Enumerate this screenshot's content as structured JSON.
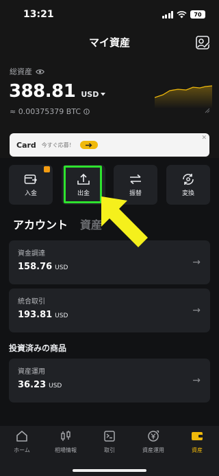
{
  "status_bar": {
    "time": "13:21",
    "battery": "70"
  },
  "header": {
    "title": "マイ資産"
  },
  "balance": {
    "label": "総資産",
    "value": "388.81",
    "currency": "USD",
    "btc_equivalent": "≈ 0.00375379 BTC"
  },
  "banner": {
    "title": "Card",
    "subtitle": "今すぐ応募！"
  },
  "actions": [
    {
      "label": "入金",
      "icon": "deposit-icon"
    },
    {
      "label": "出金",
      "icon": "withdraw-icon"
    },
    {
      "label": "振替",
      "icon": "transfer-icon"
    },
    {
      "label": "変換",
      "icon": "convert-icon"
    }
  ],
  "tabs": {
    "account": "アカウント",
    "assets": "資産"
  },
  "cards": [
    {
      "title": "資金調達",
      "value": "158.76",
      "unit": "USD"
    },
    {
      "title": "統合取引",
      "value": "193.81",
      "unit": "USD"
    },
    {
      "title": "資産運用",
      "value": "36.23",
      "unit": "USD"
    }
  ],
  "invested_heading": "投資済みの商品",
  "bottom_nav": [
    {
      "label": "ホーム",
      "icon": "home-icon"
    },
    {
      "label": "相場情報",
      "icon": "candlestick-icon"
    },
    {
      "label": "取引",
      "icon": "trade-icon"
    },
    {
      "label": "資産運用",
      "icon": "earn-icon"
    },
    {
      "label": "資産",
      "icon": "wallet-icon",
      "active": true
    }
  ],
  "colors": {
    "accent": "#f0b90b",
    "background": "#161616",
    "card": "#202226",
    "highlight": "#2ee22e",
    "pointer": "#f5f01c"
  }
}
